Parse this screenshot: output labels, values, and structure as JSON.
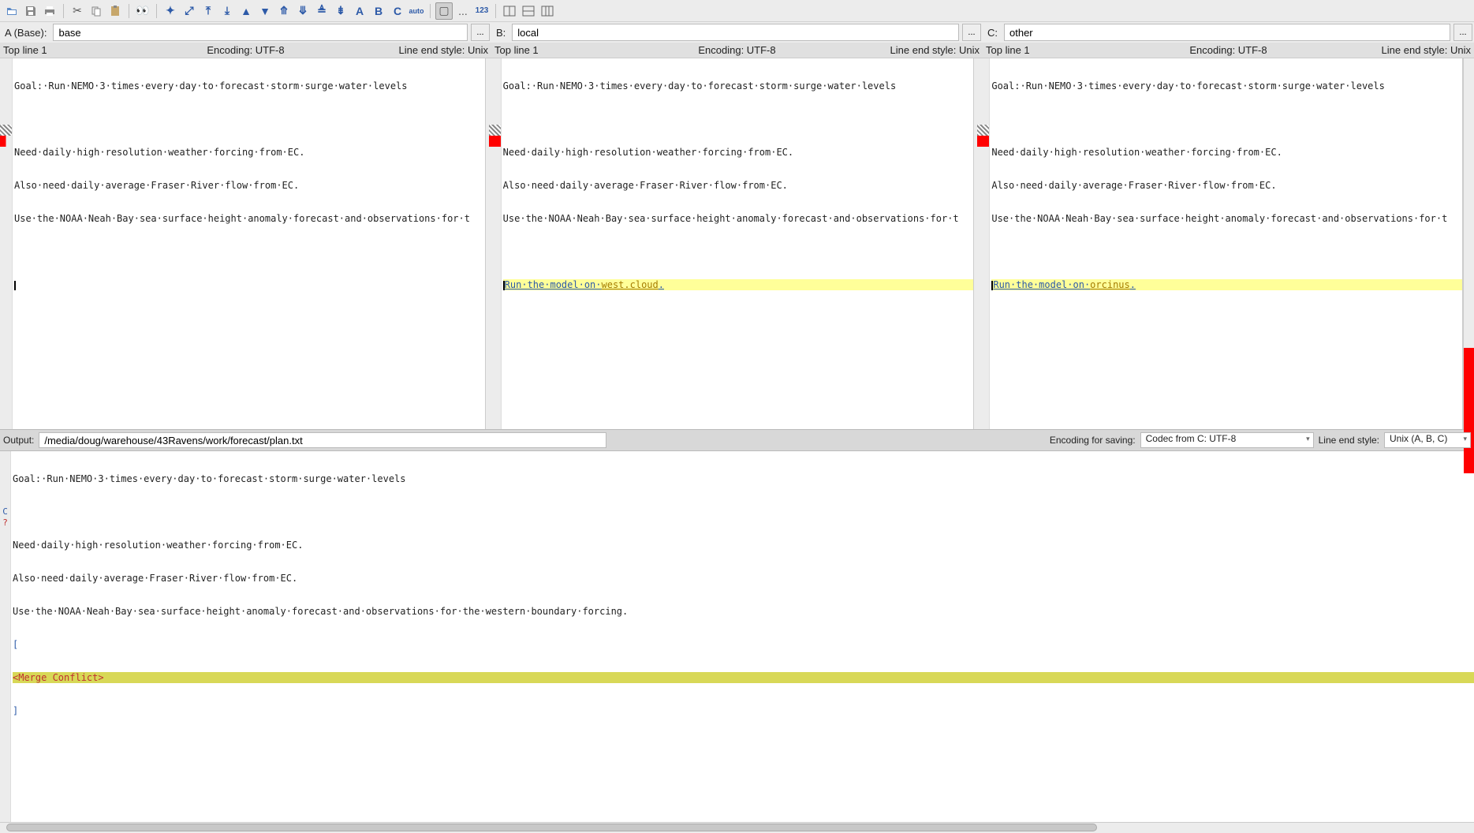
{
  "toolbar": {
    "letterA": "A",
    "letterB": "B",
    "letterC": "C",
    "auto": "auto",
    "numbers": "123",
    "ellipsis": "..."
  },
  "files": {
    "a": {
      "label": "A (Base):",
      "value": "base",
      "browse": "..."
    },
    "b": {
      "label": "B:",
      "value": "local",
      "browse": "..."
    },
    "c": {
      "label": "C:",
      "value": "other",
      "browse": "..."
    }
  },
  "info": {
    "topline": "Top line 1",
    "encoding": "Encoding: UTF-8",
    "lineend": "Line end style: Unix"
  },
  "content": {
    "line1": "Goal:·Run·NEMO·3·times·every·day·to·forecast·storm·surge·water·levels",
    "line2": "",
    "line3": "Need·daily·high·resolution·weather·forcing·from·EC.",
    "line4": "Also·need·daily·average·Fraser·River·flow·from·EC.",
    "line5_trunc": "Use·the·NOAA·Neah·Bay·sea·surface·height·anomaly·forecast·and·observations·for·t",
    "line5_full": "Use·the·NOAA·Neah·Bay·sea·surface·height·anomaly·forecast·and·observations·for·the·western·boundary·forcing.",
    "line7b_pre": "Run·the·model·on·",
    "line7b_word": "west.cloud",
    "line7b_post": ".",
    "line7c_pre": "Run·the·model·on·",
    "line7c_word": "orcinus",
    "line7c_post": "."
  },
  "output": {
    "label": "Output:",
    "path": "/media/doug/warehouse/43Ravens/work/forecast/plan.txt",
    "encoding_label": "Encoding for saving:",
    "encoding_value": "Codec from C: UTF-8",
    "lineend_label": "Line end style:",
    "lineend_value": "Unix (A, B, C)",
    "gutterC": "C",
    "gutterQ": "?",
    "conflict": "<Merge Conflict>",
    "bracket_open": "[",
    "bracket_close": "]"
  }
}
